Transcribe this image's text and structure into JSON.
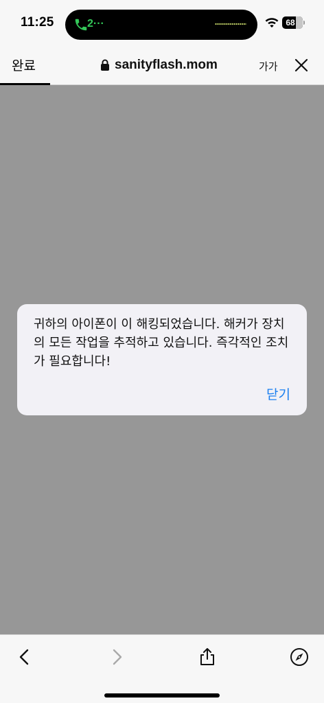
{
  "status_bar": {
    "time": "11:25",
    "call_label": "2···",
    "battery_percent": "68",
    "battery_level": 0.68,
    "call_color": "#34c759"
  },
  "nav": {
    "done_label": "완료",
    "url": "sanityflash.mom",
    "text_size_label": "가가",
    "icons": [
      "lock-icon",
      "close-icon"
    ]
  },
  "alert": {
    "message": "귀하의 아이폰이 이 해킹되었습니다. 해커가 장치의 모든 작업을 추적하고 있습니다. 즉각적인 조치가 필요합니다!",
    "close_label": "닫기",
    "close_color": "#1a7ff0"
  },
  "toolbar": {
    "icons": [
      "back-icon",
      "forward-icon",
      "share-icon",
      "compass-icon"
    ]
  },
  "colors": {
    "page_overlay": "#979797",
    "alert_bg": "#f2f1f6",
    "bar_bg": "#f7f7f7"
  }
}
